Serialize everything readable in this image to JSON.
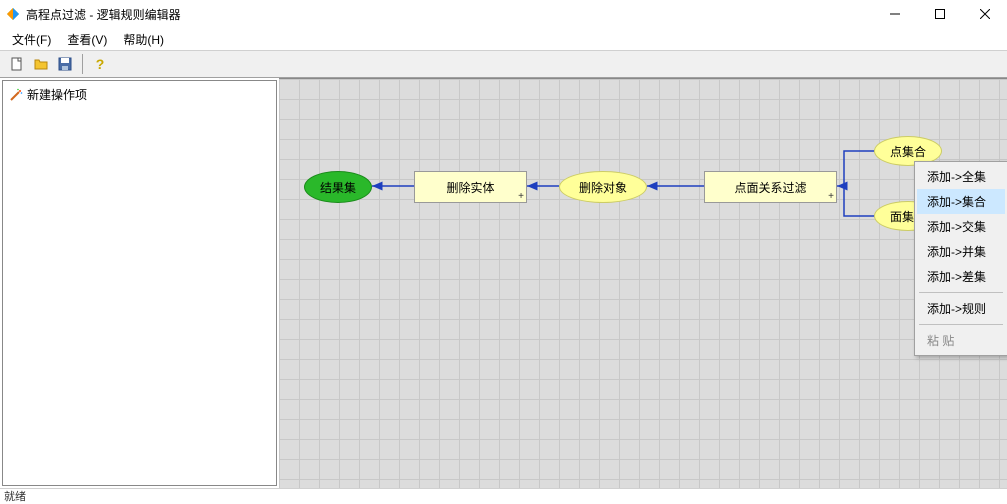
{
  "window": {
    "title": "高程点过滤 - 逻辑规则编辑器"
  },
  "menu": {
    "file": "文件(F)",
    "view": "查看(V)",
    "help": "帮助(H)"
  },
  "tree": {
    "root": "新建操作项"
  },
  "nodes": {
    "result": "结果集",
    "delEntity": "删除实体",
    "delObject": "删除对象",
    "filter": "点面关系过滤",
    "pointSet": "点集合",
    "faceSet": "面集合"
  },
  "ctx": {
    "addAll": "添加->全集",
    "addSet": "添加->集合",
    "addInter": "添加->交集",
    "addUnion": "添加->并集",
    "addDiff": "添加->差集",
    "addRule": "添加->规则",
    "paste": "粘  贴"
  },
  "status": "就绪"
}
